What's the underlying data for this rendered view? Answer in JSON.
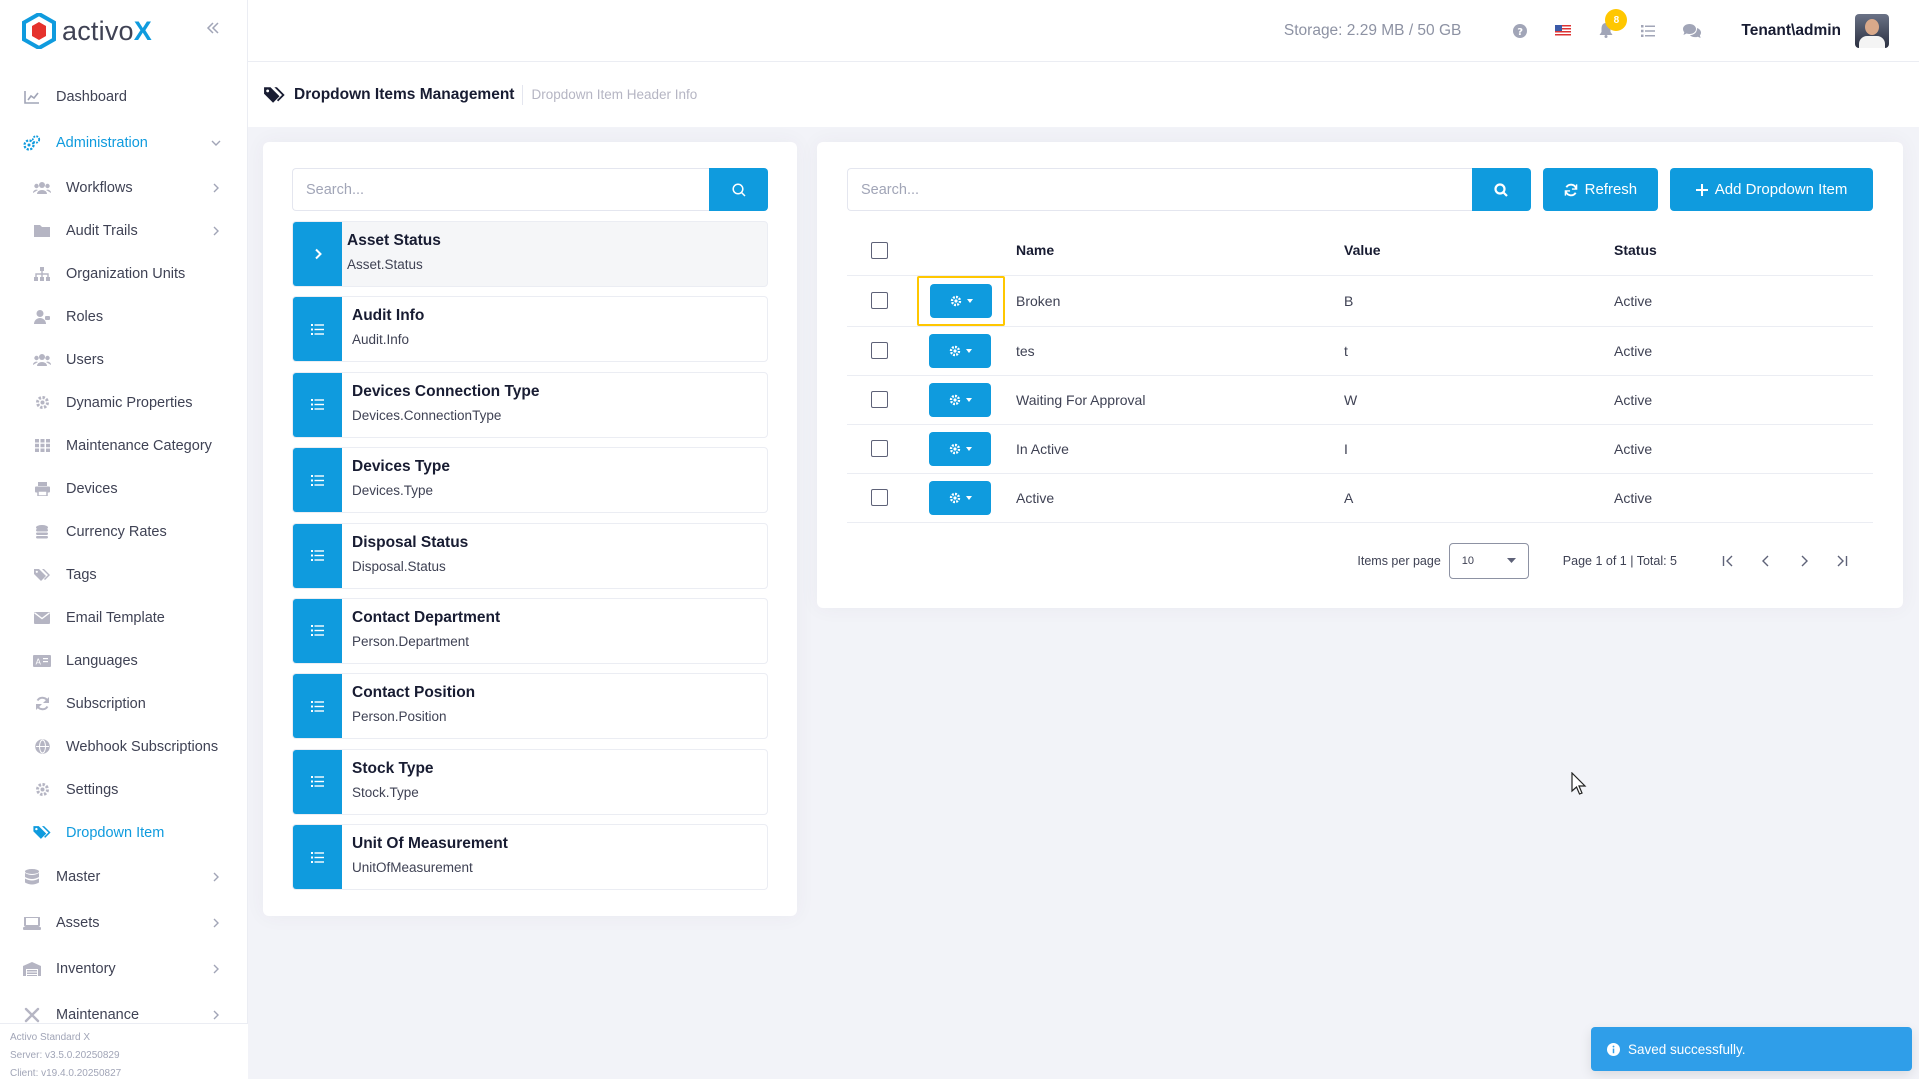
{
  "app": {
    "brand_prefix": "activo",
    "brand_suffix": "X",
    "accent_color": "#0f9bde"
  },
  "header": {
    "storage": "Storage: 2.29 MB / 50 GB",
    "notification_count": "8",
    "user": "Tenant\\admin"
  },
  "sidebar": {
    "top_items": [
      {
        "label": "Dashboard",
        "icon": "chart-line-icon"
      },
      {
        "label": "Administration",
        "icon": "cogs-icon"
      }
    ],
    "admin_items": [
      {
        "label": "Workflows",
        "icon": "users-icon"
      },
      {
        "label": "Audit Trails",
        "icon": "folder-icon"
      },
      {
        "label": "Organization Units",
        "icon": "sitemap-icon"
      },
      {
        "label": "Roles",
        "icon": "user-tag-icon"
      },
      {
        "label": "Users",
        "icon": "users-icon"
      },
      {
        "label": "Dynamic Properties",
        "icon": "cog-icon"
      },
      {
        "label": "Maintenance Category",
        "icon": "grid-icon"
      },
      {
        "label": "Devices",
        "icon": "print-icon"
      },
      {
        "label": "Currency Rates",
        "icon": "coins-icon"
      },
      {
        "label": "Tags",
        "icon": "tags-icon"
      },
      {
        "label": "Email Template",
        "icon": "envelope-icon"
      },
      {
        "label": "Languages",
        "icon": "language-icon"
      },
      {
        "label": "Subscription",
        "icon": "sync-icon"
      },
      {
        "label": "Webhook Subscriptions",
        "icon": "globe-icon"
      },
      {
        "label": "Settings",
        "icon": "cog-icon"
      },
      {
        "label": "Dropdown Item",
        "icon": "tags-icon"
      }
    ],
    "bottom_items": [
      {
        "label": "Master",
        "icon": "database-icon"
      },
      {
        "label": "Assets",
        "icon": "laptop-icon"
      },
      {
        "label": "Inventory",
        "icon": "warehouse-icon"
      },
      {
        "label": "Maintenance",
        "icon": "tools-icon"
      }
    ],
    "footer": {
      "product": "Activo Standard X",
      "server": "Server: v3.5.0.20250829",
      "client": "Client: v19.4.0.20250827"
    }
  },
  "subheader": {
    "title": "Dropdown Items Management",
    "description": "Dropdown Item Header Info"
  },
  "left_panel": {
    "search_placeholder": "Search...",
    "headers": [
      {
        "name": "Asset Status",
        "code": "Asset.Status",
        "selected": true
      },
      {
        "name": "Audit Info",
        "code": "Audit.Info"
      },
      {
        "name": "Devices Connection Type",
        "code": "Devices.ConnectionType"
      },
      {
        "name": "Devices Type",
        "code": "Devices.Type"
      },
      {
        "name": "Disposal Status",
        "code": "Disposal.Status"
      },
      {
        "name": "Contact Department",
        "code": "Person.Department"
      },
      {
        "name": "Contact Position",
        "code": "Person.Position"
      },
      {
        "name": "Stock Type",
        "code": "Stock.Type"
      },
      {
        "name": "Unit Of Measurement",
        "code": "UnitOfMeasurement"
      }
    ]
  },
  "right_panel": {
    "search_placeholder": "Search...",
    "refresh_label": "Refresh",
    "add_label": "Add Dropdown Item",
    "columns": {
      "name": "Name",
      "value": "Value",
      "status": "Status"
    },
    "rows": [
      {
        "name": "Broken",
        "value": "B",
        "status": "Active"
      },
      {
        "name": "tes",
        "value": "t",
        "status": "Active"
      },
      {
        "name": "Waiting For Approval",
        "value": "W",
        "status": "Active"
      },
      {
        "name": "In Active",
        "value": "I",
        "status": "Active"
      },
      {
        "name": "Active",
        "value": "A",
        "status": "Active"
      }
    ],
    "pager": {
      "items_per_page_label": "Items per page",
      "items_per_page": "10",
      "page_info": "Page 1 of 1 | Total: 5"
    }
  },
  "toast": {
    "message": "Saved successfully."
  }
}
